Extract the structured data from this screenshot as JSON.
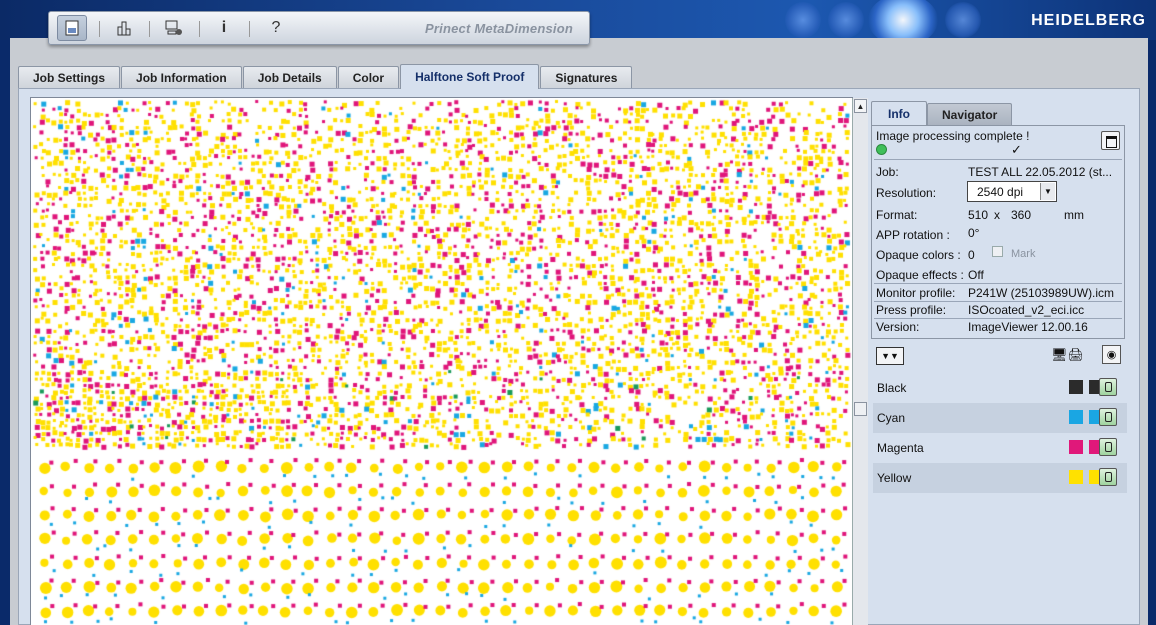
{
  "header": {
    "app_title": "Prinect MetaDimension",
    "brand": "HEIDELBERG",
    "toolbar": {
      "icons": [
        "job-ticket-icon",
        "chart-icon",
        "computer-settings-icon",
        "info-icon",
        "help-icon"
      ],
      "info_glyph": "i",
      "help_glyph": "?"
    }
  },
  "tabs": [
    "Job Settings",
    "Job Information",
    "Job Details",
    "Color",
    "Halftone Soft Proof",
    "Signatures"
  ],
  "active_tab": "Halftone Soft Proof",
  "panel_tabs": [
    "Info",
    "Navigator"
  ],
  "info": {
    "status": "Image processing complete !",
    "status_check": "✓",
    "job_label": "Job:",
    "job_value": "TEST ALL 22.05.2012 (st...",
    "resolution_label": "Resolution:",
    "resolution_value": "2540 dpi",
    "format_label": "Format:",
    "format_width": "510",
    "format_x": "x",
    "format_height": "360",
    "format_unit": "mm",
    "rotation_label": "APP rotation :",
    "rotation_value": "0°",
    "opaque_colors_label": "Opaque colors :",
    "opaque_colors_value": "0",
    "mark_label": "Mark",
    "opaque_effects_label": "Opaque effects :",
    "opaque_effects_value": "Off",
    "monitor_profile_label": "Monitor profile:",
    "monitor_profile_value": "P241W (25103989UW).icm",
    "press_profile_label": "Press profile:",
    "press_profile_value": "ISOcoated_v2_eci.icc",
    "version_label": "Version:",
    "version_value": "ImageViewer 12.00.16"
  },
  "separations": [
    {
      "name": "Black",
      "color": "#2b2b2b"
    },
    {
      "name": "Cyan",
      "color": "#1aa6e3"
    },
    {
      "name": "Magenta",
      "color": "#e0187a"
    },
    {
      "name": "Yellow",
      "color": "#ffe100"
    }
  ],
  "colors": {
    "cyan": "#19a8e2",
    "magenta": "#e0157a",
    "yellow": "#ffe000",
    "black": "#2b2b2b",
    "status_ok": "#3fbf5a"
  }
}
